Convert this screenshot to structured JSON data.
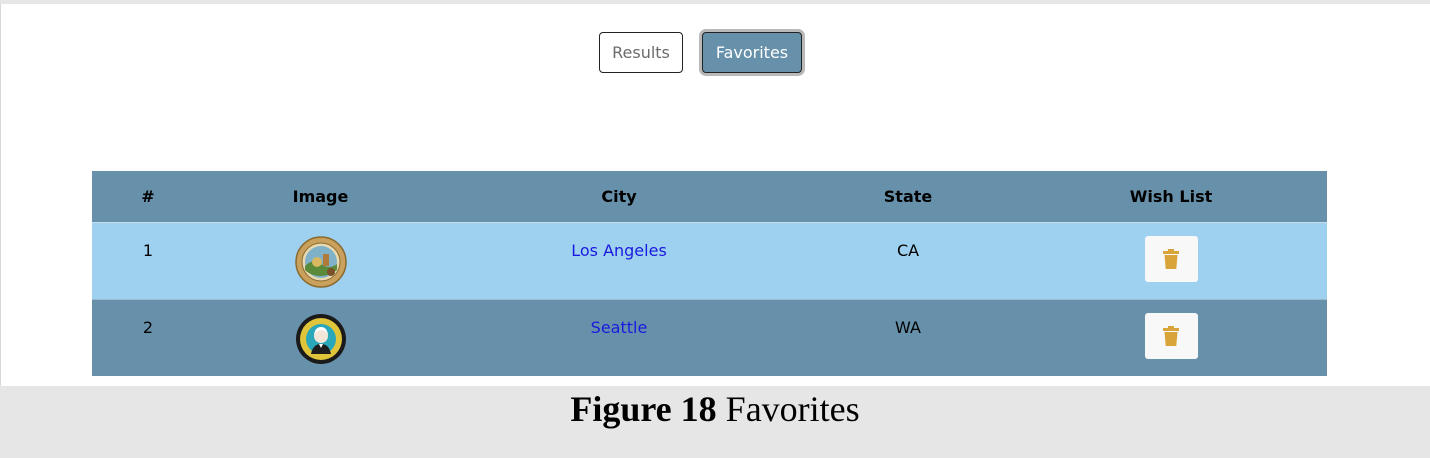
{
  "toggle": {
    "results_label": "Results",
    "favorites_label": "Favorites",
    "active": "Favorites"
  },
  "table": {
    "headers": [
      "#",
      "Image",
      "City",
      "State",
      "Wish List"
    ],
    "rows": [
      {
        "index": "1",
        "image_icon": "california-seal-icon",
        "city": "Los Angeles",
        "state": "CA",
        "action_icon": "trash-icon"
      },
      {
        "index": "2",
        "image_icon": "washington-seal-icon",
        "city": "Seattle",
        "state": "WA",
        "action_icon": "trash-icon"
      }
    ]
  },
  "caption": {
    "label": "Figure 18",
    "text": "Favorites"
  },
  "colors": {
    "header_bg": "#6791aa",
    "row_light": "#9ed1ef",
    "row_dark": "#6791aa",
    "link": "#1a1adf",
    "trash": "#d9a53a"
  }
}
